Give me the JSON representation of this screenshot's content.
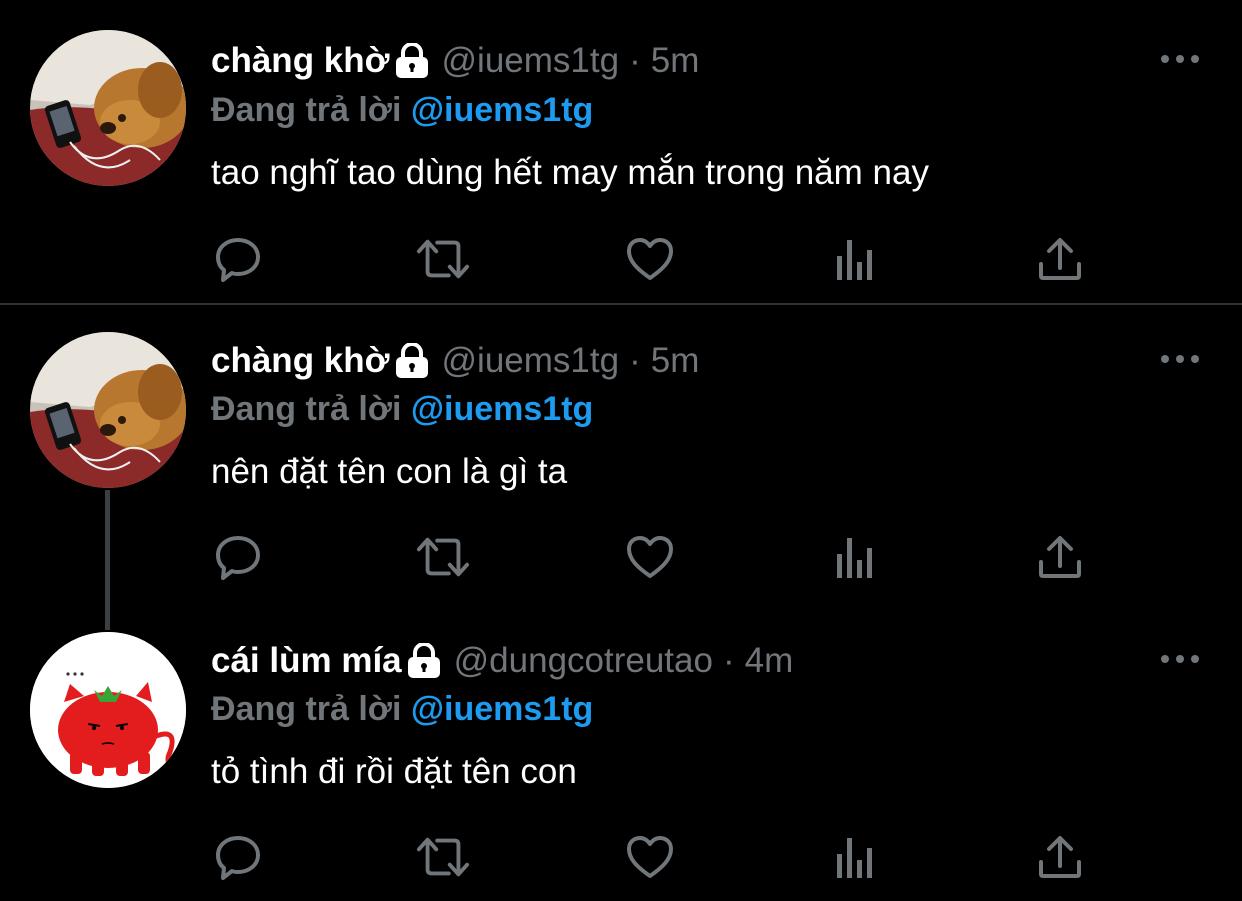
{
  "tweets": [
    {
      "display_name": "chàng khờ",
      "handle": "@iuems1tg",
      "separator": "·",
      "time": "5m",
      "reply_prefix": "Đang trả lời",
      "reply_to": "@iuems1tg",
      "text": "tao nghĩ tao dùng hết may mắn trong năm nay",
      "avatar": "dog-avatar"
    },
    {
      "display_name": "chàng khờ",
      "handle": "@iuems1tg",
      "separator": "·",
      "time": "5m",
      "reply_prefix": "Đang trả lời",
      "reply_to": "@iuems1tg",
      "text": "nên đặt tên con là gì ta",
      "avatar": "dog-avatar"
    },
    {
      "display_name": "cái lùm mía",
      "handle": "@dungcotreutao",
      "separator": "·",
      "time": "4m",
      "reply_prefix": "Đang trả lời",
      "reply_to": "@iuems1tg",
      "text": "tỏ tình đi rồi đặt tên con",
      "avatar": "tomato-cat-avatar"
    }
  ],
  "actions": [
    "reply-icon",
    "retweet-icon",
    "like-icon",
    "analytics-icon",
    "share-icon"
  ],
  "colors": {
    "background": "#000000",
    "text_primary": "#ffffff",
    "text_secondary": "#71767b",
    "link": "#1d9bf0",
    "divider": "#2f3336",
    "thread_line": "#3a3f44",
    "icon": "#71767b"
  }
}
